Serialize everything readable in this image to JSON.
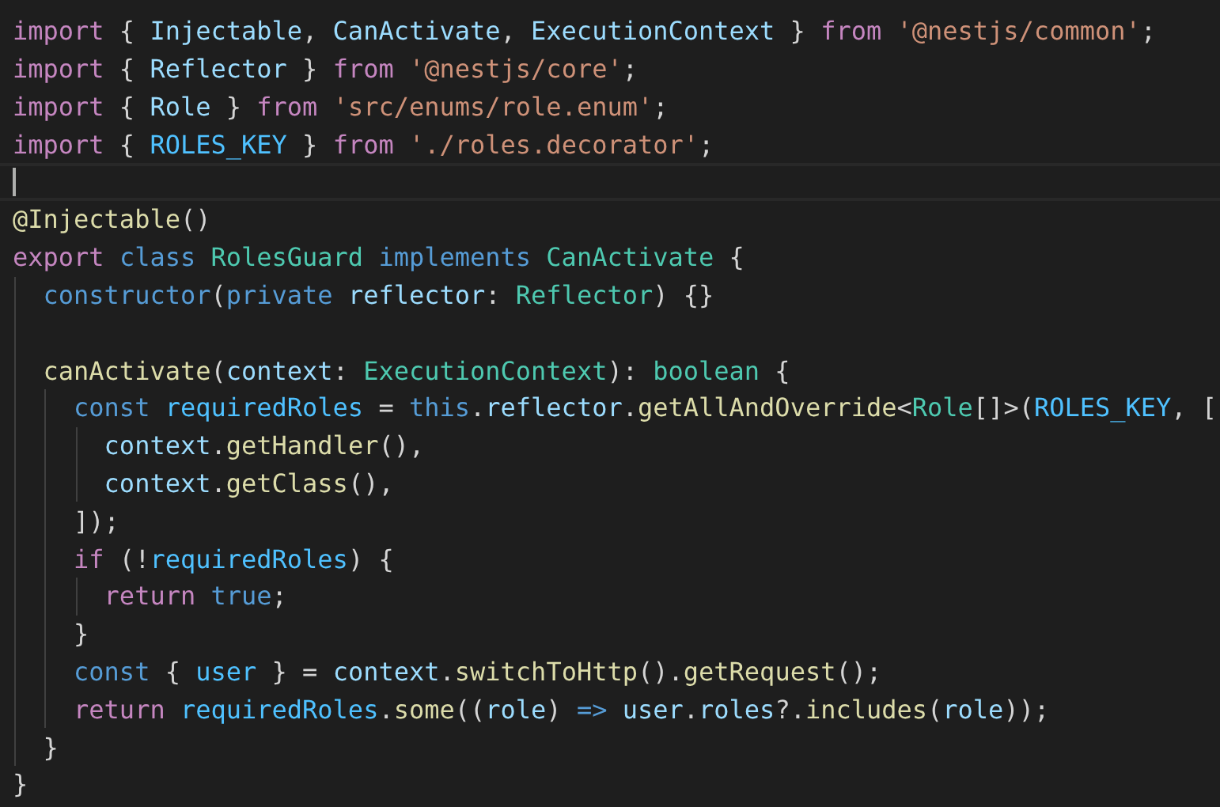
{
  "editor": {
    "lines": [
      {
        "current": false,
        "tokens": [
          {
            "text": "import",
            "kind": "kw"
          },
          {
            "text": " { ",
            "kind": "pl"
          },
          {
            "text": "Injectable",
            "kind": "id"
          },
          {
            "text": ", ",
            "kind": "pl"
          },
          {
            "text": "CanActivate",
            "kind": "id"
          },
          {
            "text": ", ",
            "kind": "pl"
          },
          {
            "text": "ExecutionContext",
            "kind": "id"
          },
          {
            "text": " } ",
            "kind": "pl"
          },
          {
            "text": "from ",
            "kind": "kw"
          },
          {
            "text": "'@nestjs/common'",
            "kind": "str"
          },
          {
            "text": ";",
            "kind": "pl"
          }
        ]
      },
      {
        "current": false,
        "tokens": [
          {
            "text": "import",
            "kind": "kw"
          },
          {
            "text": " { ",
            "kind": "pl"
          },
          {
            "text": "Reflector",
            "kind": "id"
          },
          {
            "text": " } ",
            "kind": "pl"
          },
          {
            "text": "from ",
            "kind": "kw"
          },
          {
            "text": "'@nestjs/core'",
            "kind": "str"
          },
          {
            "text": ";",
            "kind": "pl"
          }
        ]
      },
      {
        "current": false,
        "tokens": [
          {
            "text": "import",
            "kind": "kw"
          },
          {
            "text": " { ",
            "kind": "pl"
          },
          {
            "text": "Role",
            "kind": "id"
          },
          {
            "text": " } ",
            "kind": "pl"
          },
          {
            "text": "from ",
            "kind": "kw"
          },
          {
            "text": "'src/enums/role.enum'",
            "kind": "str"
          },
          {
            "text": ";",
            "kind": "pl"
          }
        ]
      },
      {
        "current": false,
        "tokens": [
          {
            "text": "import",
            "kind": "kw"
          },
          {
            "text": " { ",
            "kind": "pl"
          },
          {
            "text": "ROLES_KEY",
            "kind": "co"
          },
          {
            "text": " } ",
            "kind": "pl"
          },
          {
            "text": "from ",
            "kind": "kw"
          },
          {
            "text": "'./roles.decorator'",
            "kind": "str"
          },
          {
            "text": ";",
            "kind": "pl"
          }
        ]
      },
      {
        "current": true
      },
      {
        "current": false,
        "tokens": [
          {
            "text": "@Injectable",
            "kind": "fn"
          },
          {
            "text": "()",
            "kind": "pl"
          }
        ]
      },
      {
        "current": false,
        "tokens": [
          {
            "text": "export ",
            "kind": "kw"
          },
          {
            "text": "class ",
            "kind": "st"
          },
          {
            "text": "RolesGuard ",
            "kind": "ty"
          },
          {
            "text": "implements ",
            "kind": "st"
          },
          {
            "text": "CanActivate",
            "kind": "ty"
          },
          {
            "text": " {",
            "kind": "pl"
          }
        ]
      },
      {
        "current": false,
        "tokens": [
          {
            "text": "  constructor",
            "kind": "st"
          },
          {
            "text": "(",
            "kind": "pl"
          },
          {
            "text": "private ",
            "kind": "st"
          },
          {
            "text": "reflector",
            "kind": "id"
          },
          {
            "text": ": ",
            "kind": "pl"
          },
          {
            "text": "Reflector",
            "kind": "ty"
          },
          {
            "text": ") {}",
            "kind": "pl"
          }
        ]
      },
      {
        "current": false
      },
      {
        "current": false,
        "tokens": [
          {
            "text": "  canActivate",
            "kind": "fn"
          },
          {
            "text": "(",
            "kind": "pl"
          },
          {
            "text": "context",
            "kind": "id"
          },
          {
            "text": ": ",
            "kind": "pl"
          },
          {
            "text": "ExecutionContext",
            "kind": "ty"
          },
          {
            "text": "): ",
            "kind": "pl"
          },
          {
            "text": "boolean",
            "kind": "ty"
          },
          {
            "text": " {",
            "kind": "pl"
          }
        ]
      },
      {
        "current": false,
        "tokens": [
          {
            "text": "    const ",
            "kind": "st"
          },
          {
            "text": "requiredRoles",
            "kind": "co"
          },
          {
            "text": " = ",
            "kind": "pl"
          },
          {
            "text": "this",
            "kind": "st"
          },
          {
            "text": ".",
            "kind": "pl"
          },
          {
            "text": "reflector",
            "kind": "id"
          },
          {
            "text": ".",
            "kind": "pl"
          },
          {
            "text": "getAllAndOverride",
            "kind": "fn"
          },
          {
            "text": "<",
            "kind": "pl"
          },
          {
            "text": "Role",
            "kind": "ty"
          },
          {
            "text": "[]>(",
            "kind": "pl"
          },
          {
            "text": "ROLES_KEY",
            "kind": "co"
          },
          {
            "text": ", [",
            "kind": "pl"
          }
        ]
      },
      {
        "current": false,
        "tokens": [
          {
            "text": "      context",
            "kind": "id"
          },
          {
            "text": ".",
            "kind": "pl"
          },
          {
            "text": "getHandler",
            "kind": "fn"
          },
          {
            "text": "(),",
            "kind": "pl"
          }
        ]
      },
      {
        "current": false,
        "tokens": [
          {
            "text": "      context",
            "kind": "id"
          },
          {
            "text": ".",
            "kind": "pl"
          },
          {
            "text": "getClass",
            "kind": "fn"
          },
          {
            "text": "(),",
            "kind": "pl"
          }
        ]
      },
      {
        "current": false,
        "tokens": [
          {
            "text": "    ]);",
            "kind": "pl"
          }
        ]
      },
      {
        "current": false,
        "tokens": [
          {
            "text": "    if",
            "kind": "kw"
          },
          {
            "text": " (!",
            "kind": "pl"
          },
          {
            "text": "requiredRoles",
            "kind": "co"
          },
          {
            "text": ") {",
            "kind": "pl"
          }
        ]
      },
      {
        "current": false,
        "tokens": [
          {
            "text": "      return ",
            "kind": "kw"
          },
          {
            "text": "true",
            "kind": "st"
          },
          {
            "text": ";",
            "kind": "pl"
          }
        ]
      },
      {
        "current": false,
        "tokens": [
          {
            "text": "    }",
            "kind": "pl"
          }
        ]
      },
      {
        "current": false,
        "tokens": [
          {
            "text": "    const",
            "kind": "st"
          },
          {
            "text": " { ",
            "kind": "pl"
          },
          {
            "text": "user",
            "kind": "co"
          },
          {
            "text": " } = ",
            "kind": "pl"
          },
          {
            "text": "context",
            "kind": "id"
          },
          {
            "text": ".",
            "kind": "pl"
          },
          {
            "text": "switchToHttp",
            "kind": "fn"
          },
          {
            "text": "().",
            "kind": "pl"
          },
          {
            "text": "getRequest",
            "kind": "fn"
          },
          {
            "text": "();",
            "kind": "pl"
          }
        ]
      },
      {
        "current": false,
        "tokens": [
          {
            "text": "    return ",
            "kind": "kw"
          },
          {
            "text": "requiredRoles",
            "kind": "co"
          },
          {
            "text": ".",
            "kind": "pl"
          },
          {
            "text": "some",
            "kind": "fn"
          },
          {
            "text": "((",
            "kind": "pl"
          },
          {
            "text": "role",
            "kind": "id"
          },
          {
            "text": ") ",
            "kind": "pl"
          },
          {
            "text": "=> ",
            "kind": "st"
          },
          {
            "text": "user",
            "kind": "id"
          },
          {
            "text": ".",
            "kind": "pl"
          },
          {
            "text": "roles",
            "kind": "id"
          },
          {
            "text": "?.",
            "kind": "pl"
          },
          {
            "text": "includes",
            "kind": "fn"
          },
          {
            "text": "(",
            "kind": "pl"
          },
          {
            "text": "role",
            "kind": "id"
          },
          {
            "text": "));",
            "kind": "pl"
          }
        ]
      },
      {
        "current": false,
        "tokens": [
          {
            "text": "  }",
            "kind": "pl"
          }
        ]
      },
      {
        "current": false,
        "tokens": [
          {
            "text": "}",
            "kind": "pl"
          }
        ]
      }
    ]
  }
}
